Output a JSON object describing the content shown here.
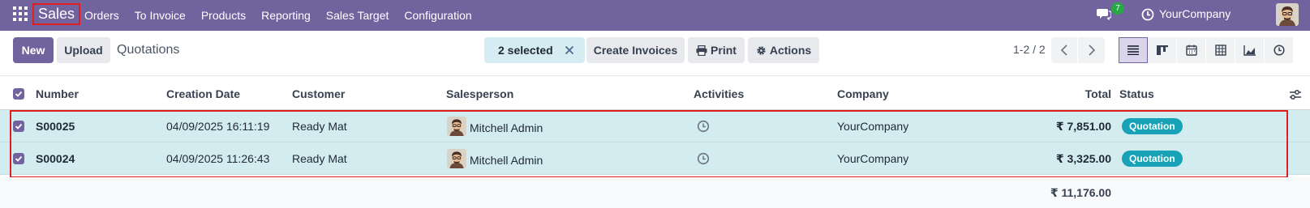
{
  "navbar": {
    "apps_icon": "grid-icon",
    "app_name": "Sales",
    "menu": [
      "Orders",
      "To Invoice",
      "Products",
      "Reporting",
      "Sales Target",
      "Configuration"
    ],
    "chat_icon": "chat-icon",
    "chat_count": "7",
    "activity_icon": "clock-icon",
    "company": "YourCompany",
    "avatar_icon": "user-avatar"
  },
  "control_panel": {
    "new_label": "New",
    "upload_label": "Upload",
    "title": "Quotations",
    "selection_text": "2 selected",
    "clear_icon": "close-icon",
    "create_invoices_label": "Create Invoices",
    "print_label": "Print",
    "print_icon": "printer-icon",
    "actions_label": "Actions",
    "actions_icon": "gear-icon",
    "pager_value": "1-2 / 2",
    "views": [
      "list",
      "kanban",
      "calendar",
      "pivot",
      "graph",
      "activity"
    ],
    "active_view": "list"
  },
  "table": {
    "columns": [
      "Number",
      "Creation Date",
      "Customer",
      "Salesperson",
      "Activities",
      "Company",
      "Total",
      "Status"
    ],
    "rows": [
      {
        "number": "S00025",
        "creation_date": "04/09/2025 16:11:19",
        "customer": "Ready Mat",
        "salesperson": "Mitchell Admin",
        "company": "YourCompany",
        "total": "₹ 7,851.00",
        "status": "Quotation",
        "selected": true
      },
      {
        "number": "S00024",
        "creation_date": "04/09/2025 11:26:43",
        "customer": "Ready Mat",
        "salesperson": "Mitchell Admin",
        "company": "YourCompany",
        "total": "₹ 3,325.00",
        "status": "Quotation",
        "selected": true
      }
    ],
    "footer_total": "₹ 11,176.00"
  },
  "colors": {
    "navbar": "#71639e",
    "primary_button": "#71639e",
    "selected_row": "#d3ecef",
    "status_badge": "#17a2b8",
    "highlight_frame": "#e01e1e"
  }
}
